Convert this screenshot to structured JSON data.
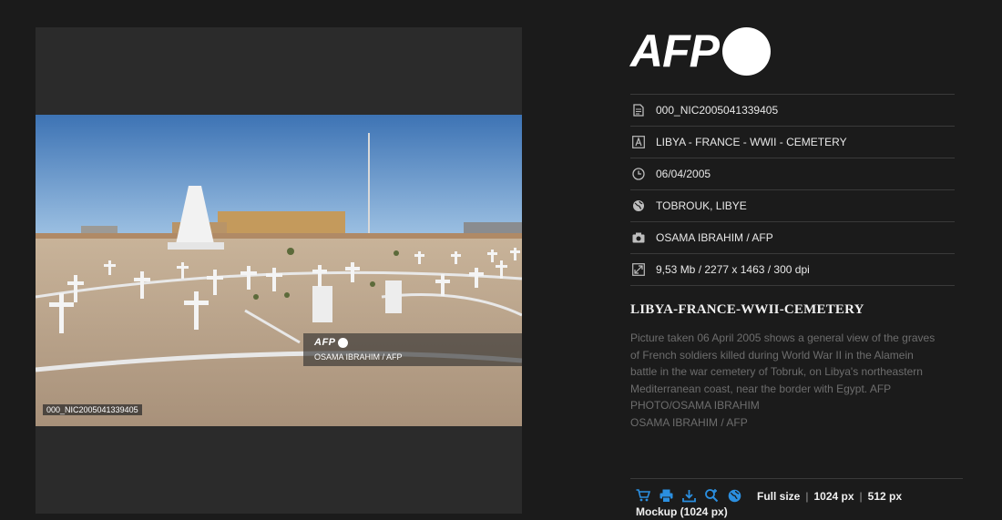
{
  "viewer": {
    "watermark_logo": "AFP",
    "watermark_credit": "OSAMA IBRAHIM / AFP",
    "photo_id": "000_NIC2005041339405"
  },
  "brand": {
    "logo_text": "AFP"
  },
  "meta": [
    {
      "icon": "document-icon",
      "value": "000_NIC2005041339405"
    },
    {
      "icon": "title-icon",
      "value": "LIBYA - FRANCE - WWII - CEMETERY"
    },
    {
      "icon": "clock-icon",
      "value": "06/04/2005"
    },
    {
      "icon": "globe-icon",
      "value": "TOBROUK, LIBYE"
    },
    {
      "icon": "camera-icon",
      "value": "OSAMA IBRAHIM / AFP"
    },
    {
      "icon": "resize-icon",
      "value": "9,53 Mb / 2277 x 1463 / 300 dpi"
    }
  ],
  "caption": {
    "title": "LIBYA-FRANCE-WWII-CEMETERY",
    "lines": [
      "Picture taken 06 April 2005 shows a general view of the graves",
      "of French soldiers killed during World War II in the Alamein",
      "battle in the war cemetery of Tobruk, on Libya's northeastern",
      "Mediterranean coast, near the border with Egypt. AFP",
      "PHOTO/OSAMA IBRAHIM",
      "OSAMA IBRAHIM / AFP"
    ]
  },
  "downloads": {
    "icons": [
      "cart-icon",
      "print-icon",
      "download-icon",
      "zoom-in-icon",
      "globe-icon"
    ],
    "accent": "#2b8fe0",
    "full_size": "Full size",
    "sep": "|",
    "size_1024": "1024 px",
    "size_512": "512 px",
    "mockup": "Mockup (1024 px)"
  }
}
